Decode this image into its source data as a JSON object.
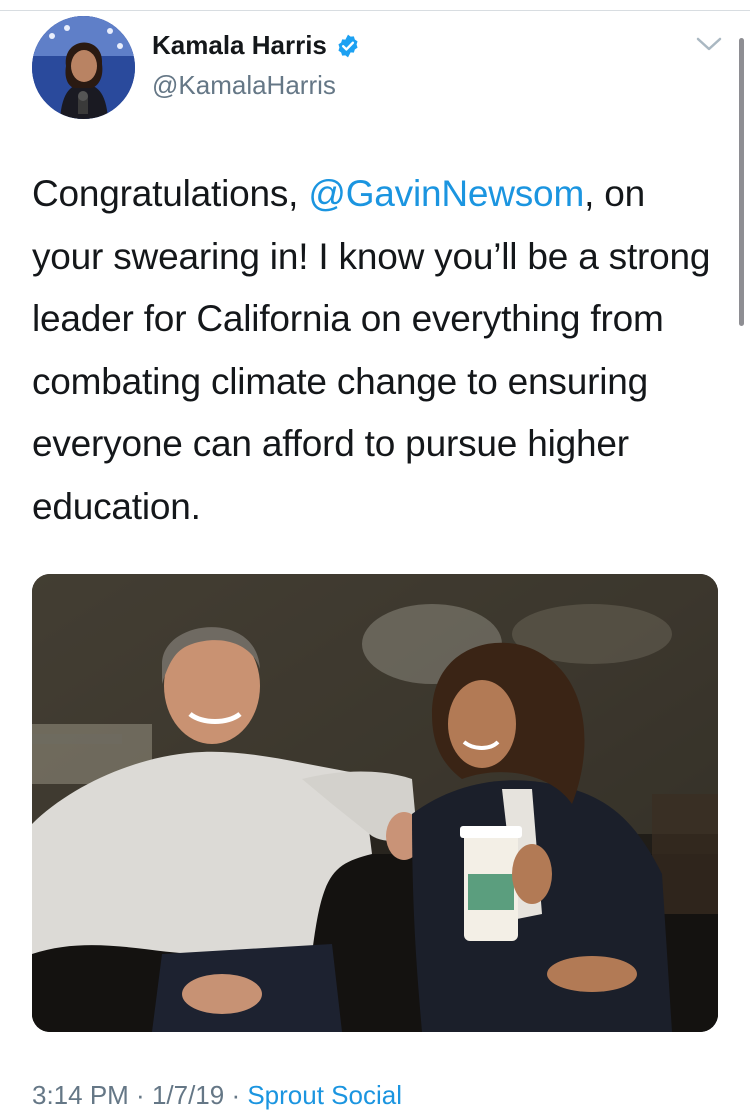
{
  "tweet": {
    "author": {
      "display_name": "Kamala Harris",
      "handle": "@KamalaHarris",
      "verified": true
    },
    "text_segments": {
      "part1": "Congratulations, ",
      "mention": "@GavinNewsom",
      "part2": ", on your swearing in! I know you’ll be a strong leader for California on everything from combating climate change to ensuring everyone can afford to pursue higher education."
    },
    "meta": {
      "time": "3:14 PM",
      "separator1": " · ",
      "date": "1/7/19",
      "separator2": " · ",
      "source": "Sprout Social"
    }
  },
  "icons": {
    "verified": "verified-badge-icon",
    "menu": "chevron-down-icon"
  },
  "colors": {
    "link": "#1b95e0",
    "secondary_text": "#657786",
    "primary_text": "#14171a",
    "verified": "#1da1f2"
  }
}
